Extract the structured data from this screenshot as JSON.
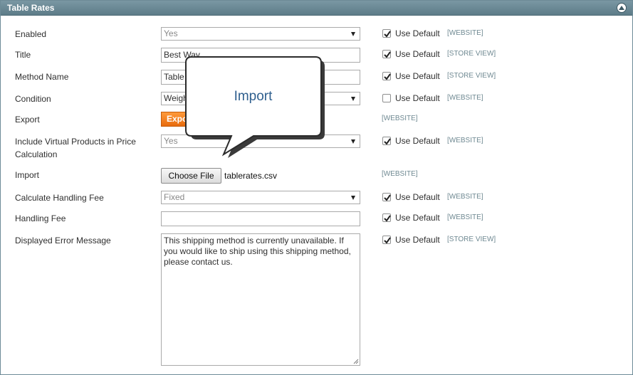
{
  "panel": {
    "title": "Table Rates"
  },
  "rows": [
    {
      "label": "Enabled",
      "value": "Yes",
      "use_default_checked": true,
      "use_default": "Use Default",
      "scope": "[WEBSITE]"
    },
    {
      "label": "Title",
      "value": "Best Way",
      "use_default_checked": true,
      "use_default": "Use Default",
      "scope": "[STORE VIEW]"
    },
    {
      "label": "Method Name",
      "value": "Table Rate",
      "use_default_checked": true,
      "use_default": "Use Default",
      "scope": "[STORE VIEW]"
    },
    {
      "label": "Condition",
      "value": "Weight vs. Destination",
      "use_default_checked": false,
      "use_default": "Use Default",
      "scope": "[WEBSITE]"
    },
    {
      "label": "Export",
      "button_label": "Export CSV",
      "scope": "[WEBSITE]"
    },
    {
      "label": "Include Virtual Products in Price Calculation",
      "value": "Yes",
      "use_default_checked": true,
      "use_default": "Use Default",
      "scope": "[WEBSITE]"
    },
    {
      "label": "Import",
      "button_label": "Choose File",
      "file_name": "tablerates.csv",
      "scope": "[WEBSITE]"
    },
    {
      "label": "Calculate Handling Fee",
      "value": "Fixed",
      "use_default_checked": true,
      "use_default": "Use Default",
      "scope": "[WEBSITE]"
    },
    {
      "label": "Handling Fee",
      "value": "",
      "use_default_checked": true,
      "use_default": "Use Default",
      "scope": "[WEBSITE]"
    },
    {
      "label": "Displayed Error Message",
      "value": "This shipping method is currently unavailable. If you would like to ship using this shipping method, please contact us.",
      "use_default_checked": true,
      "use_default": "Use Default",
      "scope": "[STORE VIEW]"
    }
  ],
  "callout": {
    "text": "Import"
  },
  "colors": {
    "header": "#6b8a96",
    "export_button": "#f3841f",
    "scope_text": "#6f8992",
    "callout_text": "#2f5f8e"
  }
}
